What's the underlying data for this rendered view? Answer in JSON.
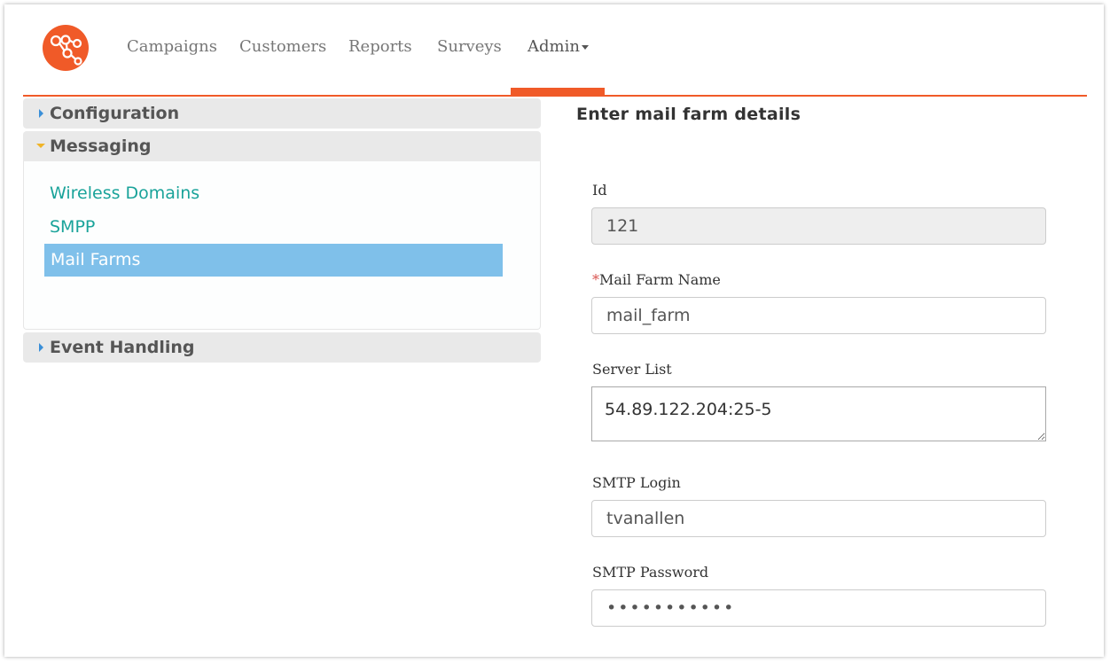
{
  "header": {
    "nav": [
      {
        "label": "Campaigns"
      },
      {
        "label": "Customers"
      },
      {
        "label": "Reports"
      },
      {
        "label": "Surveys"
      },
      {
        "label": "Admin"
      }
    ],
    "active_nav": "Admin",
    "accent_color": "#f05a28",
    "logo_icon": "network-nodes-icon"
  },
  "sidebar": {
    "sections": [
      {
        "label": "Configuration",
        "expanded": false
      },
      {
        "label": "Messaging",
        "expanded": true
      },
      {
        "label": "Event Handling",
        "expanded": false
      }
    ],
    "messaging_items": [
      {
        "label": "Wireless Domains"
      },
      {
        "label": "SMPP"
      },
      {
        "label": "Mail Farms"
      }
    ],
    "selected_item": "Mail Farms",
    "link_color": "#1aa39a",
    "selected_color": "#7fc0ea"
  },
  "form": {
    "title": "Enter mail farm details",
    "id": {
      "label": "Id",
      "value": "121"
    },
    "mail_farm_name": {
      "required_mark": "*",
      "label": "Mail Farm Name",
      "value": "mail_farm"
    },
    "server_list": {
      "label": "Server List",
      "value": "54.89.122.204:25-5"
    },
    "smtp_login": {
      "label": "SMTP Login",
      "value": "tvanallen"
    },
    "smtp_password": {
      "label": "SMTP Password",
      "value": "tvanallen12"
    }
  }
}
